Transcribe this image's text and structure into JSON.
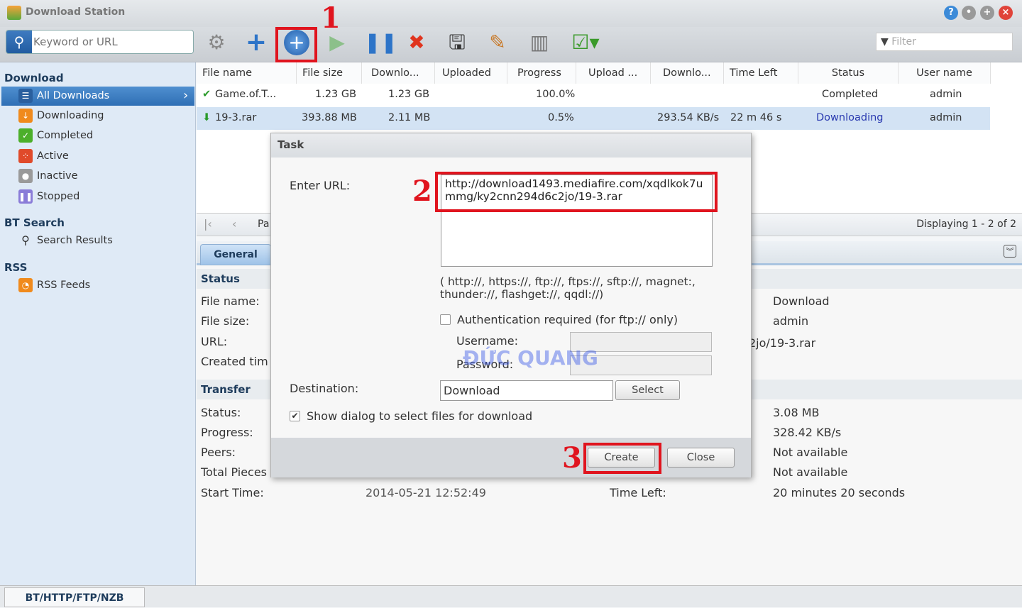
{
  "app": {
    "title": "Download Station",
    "window_buttons": [
      "help",
      "minimize",
      "maximize",
      "close"
    ]
  },
  "toolbar": {
    "search_placeholder": "Keyword or URL",
    "filter_placeholder": "Filter",
    "icons": [
      "settings-icon",
      "add-icon",
      "add-url-icon",
      "resume-icon",
      "pause-icon",
      "delete-icon",
      "save-icon",
      "edit-icon",
      "clear-icon",
      "select-icon"
    ]
  },
  "sidebar": {
    "download_header": "Download",
    "items": [
      {
        "label": "All Downloads",
        "color": "#2f6fb5"
      },
      {
        "label": "Downloading",
        "color": "#f08a1c"
      },
      {
        "label": "Completed",
        "color": "#4caf2a"
      },
      {
        "label": "Active",
        "color": "#e04a2a"
      },
      {
        "label": "Inactive",
        "color": "#9a9a9a"
      },
      {
        "label": "Stopped",
        "color": "#8a7cd8"
      }
    ],
    "bt_header": "BT Search",
    "bt_items": [
      {
        "label": "Search Results"
      }
    ],
    "rss_header": "RSS",
    "rss_items": [
      {
        "label": "RSS Feeds"
      }
    ]
  },
  "table": {
    "columns": [
      "File name",
      "File size",
      "Downlo...",
      "Uploaded",
      "Progress",
      "Upload ...",
      "Downlo...",
      "Time Left",
      "Status",
      "User name"
    ],
    "rows": [
      {
        "name": "Game.of.T...",
        "size": "1.23 GB",
        "downloaded": "1.23 GB",
        "uploaded": "",
        "progress": "100.0%",
        "upload_speed": "",
        "download_speed": "",
        "time_left": "",
        "status": "Completed",
        "user": "admin"
      },
      {
        "name": "19-3.rar",
        "size": "393.88 MB",
        "downloaded": "2.11 MB",
        "uploaded": "",
        "progress": "0.5%",
        "upload_speed": "",
        "download_speed": "293.54 KB/s",
        "time_left": "22 m 46 s",
        "status": "Downloading",
        "user": "admin"
      }
    ]
  },
  "pager": {
    "page_label": "Pa",
    "displaying": "Displaying 1 - 2 of 2"
  },
  "details": {
    "tab": "General",
    "status_header": "Status",
    "status_labels": [
      "File name:",
      "File size:",
      "URL:",
      "Created tim"
    ],
    "status_values": [
      "Download",
      "admin",
      "2jo/19-3.rar"
    ],
    "transfer_header": "Transfer",
    "transfer_labels": [
      "Status:",
      "Progress:",
      "Peers:",
      "Total Pieces",
      "Start Time:"
    ],
    "start_time": "2014-05-21 12:52:49",
    "time_left_label": "Time Left:",
    "transfer_values": [
      "3.08 MB",
      "328.42 KB/s",
      "Not available",
      "Not available",
      "20 minutes 20 seconds"
    ]
  },
  "dialog": {
    "title": "Task",
    "url_label": "Enter URL:",
    "url_value": "http://download1493.mediafire.com/xqdlkok7ummg/ky2cnn294d6c2jo/19-3.rar",
    "protocols": "( http://, https://, ftp://, ftps://, sftp://, magnet:, thunder://, flashget://, qqdl://)",
    "auth_label": "Authentication required (for ftp:// only)",
    "auth_checked": false,
    "username_label": "Username:",
    "password_label": "Password:",
    "destination_label": "Destination:",
    "destination_value": "Download",
    "select_button": "Select",
    "show_dialog_label": "Show dialog to select files for download",
    "show_dialog_checked": true,
    "create_button": "Create",
    "close_button": "Close"
  },
  "annotations": [
    "1",
    "2",
    "3"
  ],
  "watermark": "ĐỨC QUANG",
  "bottom_tab": "BT/HTTP/FTP/NZB"
}
